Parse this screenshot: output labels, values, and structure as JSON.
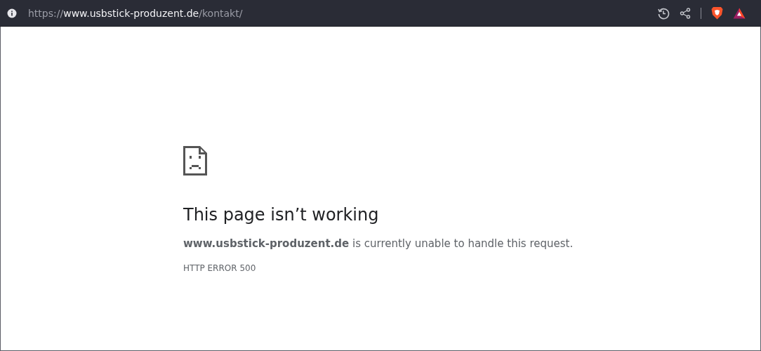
{
  "address_bar": {
    "scheme": "https://",
    "host": "www.usbstick-produzent.de",
    "path": "/kontakt/"
  },
  "error": {
    "heading": "This page isn’t working",
    "message": "**www.usbstick-produzent.de** is currently unable to handle this request.",
    "code": "HTTP ERROR 500"
  }
}
